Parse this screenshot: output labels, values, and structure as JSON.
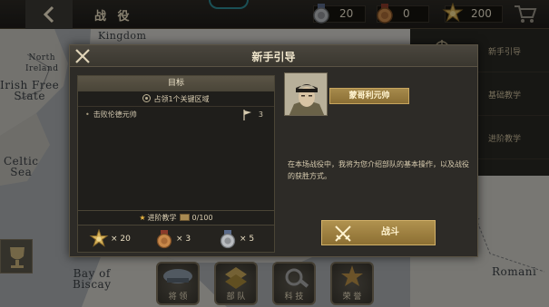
{
  "top_bar": {
    "title": "战 役",
    "resources": [
      {
        "icon": "silver-medal-icon",
        "value": "20"
      },
      {
        "icon": "bronze-medal-icon",
        "value": "0"
      },
      {
        "icon": "gold-star-medal-icon",
        "value": "200"
      }
    ]
  },
  "side_panel": {
    "tabs": [
      {
        "label": "新手引导"
      },
      {
        "label": "基础教学"
      },
      {
        "label": "进阶教学"
      }
    ]
  },
  "bottom_nav": [
    {
      "label": "将 领"
    },
    {
      "label": "部 队"
    },
    {
      "label": "科 技"
    },
    {
      "label": "荣 誉"
    }
  ],
  "map_labels": {
    "kingdom": "Kingdom",
    "north_ireland": "North\nIreland",
    "irish_free_state": "Irish Free\nState",
    "celtic_sea": "Celtic\nSea",
    "bay_of_biscay": "Bay of\nBiscay",
    "romania": "Romani"
  },
  "modal": {
    "title": "新手引导",
    "objective": {
      "header": "目标",
      "target": "占领1个关键区域",
      "items": [
        {
          "text": "击败伦德元帅",
          "count": "3"
        }
      ]
    },
    "progress": {
      "label": "进阶教学",
      "value": "0/100"
    },
    "rewards": [
      {
        "icon": "gold-star-medal-icon",
        "value": "× 20"
      },
      {
        "icon": "bronze-medal-icon",
        "value": "× 3"
      },
      {
        "icon": "silver-medal-icon",
        "value": "× 5"
      }
    ],
    "commander": {
      "name": "蒙哥利元帅"
    },
    "description": "在本场战役中，我将为您介绍部队的基本操作，以及战役的获胜方式。",
    "fight_label": "战斗"
  },
  "colors": {
    "gold_accent": "#b0924f",
    "panel_bg": "#2d2b27",
    "topbar_bg": "#1e1c19",
    "map_water": "#a9adb0",
    "map_land": "#d2d1cb"
  }
}
